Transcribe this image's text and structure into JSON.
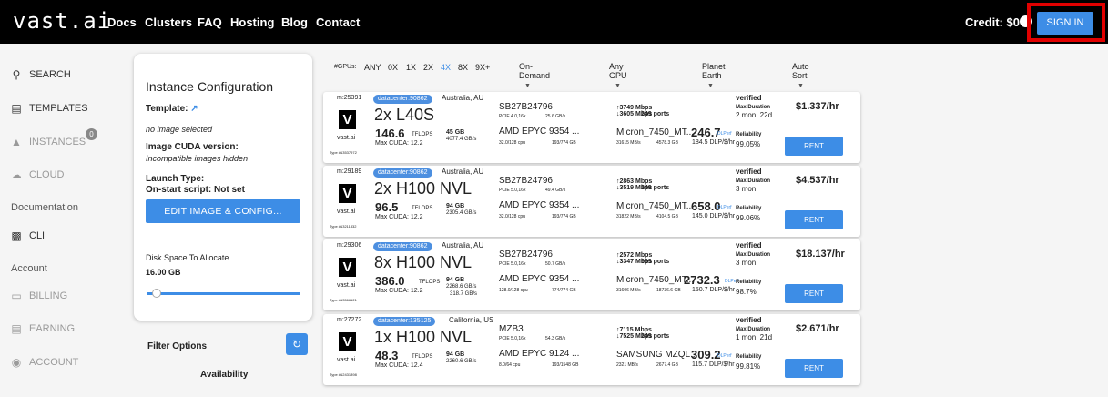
{
  "topbar": {
    "logo": "vast.ai",
    "nav": [
      "Docs",
      "Clusters",
      "FAQ",
      "Hosting",
      "Blog",
      "Contact"
    ],
    "credit": "Credit: $0",
    "sign_in": "SIGN IN"
  },
  "sidebar": {
    "items": [
      {
        "label": "SEARCH",
        "icon": "search-icon"
      },
      {
        "label": "TEMPLATES",
        "icon": "templates-icon"
      },
      {
        "label": "INSTANCES",
        "icon": "instances-icon",
        "badge": "0"
      },
      {
        "label": "CLOUD",
        "icon": "cloud-icon"
      },
      {
        "label": "Documentation"
      },
      {
        "label": "CLI",
        "icon": "terminal-icon"
      },
      {
        "label": "Account"
      },
      {
        "label": "BILLING",
        "icon": "billing-icon"
      },
      {
        "label": "EARNING",
        "icon": "earning-icon"
      },
      {
        "label": "ACCOUNT",
        "icon": "account-icon"
      }
    ]
  },
  "config": {
    "title": "Instance Configuration",
    "template_label": "Template:",
    "no_image": "no image selected",
    "cuda_label": "Image CUDA version:",
    "cuda_note": "Incompatible images hidden",
    "launch_label": "Launch Type:",
    "onstart": "On-start script: Not set",
    "edit_button": "EDIT IMAGE & CONFIG...",
    "disk_label": "Disk Space To Allocate",
    "disk_value": "16.00 GB",
    "disk_fraction": 0.05,
    "filter_label": "Filter Options",
    "availability_label": "Availability"
  },
  "filters": {
    "gpus_label": "#GPUs:",
    "gpu_options": [
      "ANY",
      "0X",
      "1X",
      "2X",
      "4X",
      "8X",
      "9X+"
    ],
    "selected_gpu_option": "4X",
    "dropdowns": [
      "On-Demand",
      "Any GPU",
      "Planet Earth",
      "Auto Sort"
    ]
  },
  "offers": [
    {
      "machine_id": "m:25391",
      "datacenter": "datacenter:90862",
      "location": "Australia, AU",
      "gpu": "2x L40S",
      "tflops": "146.6",
      "tflops_unit": "TFLOPS",
      "max_cuda": "Max CUDA: 12.2",
      "vram": "45 GB",
      "vram_bw": "4077.4 GB/s",
      "host_name": "vast.ai",
      "type_id": "Type #13537972",
      "motherboard": "SB27B24796",
      "pcie": "PCIE 4.0,16x",
      "pcie_bw": "25.6 GB/s",
      "cpu": "AMD EPYC 9354 ...",
      "cpu_cores": "32.0/128 cpu",
      "ram": "193/774 GB",
      "up": "↑3749 Mbps",
      "down": "↓3605 Mbps",
      "ports": "249 ports",
      "disk": "Micron_7450_MT...",
      "disk_bw": "31615 MB/s",
      "disk_size": "4578.3 GB",
      "dlperf": "246.7",
      "dlperf_unit": "DLPerf",
      "dlperf_per_dollar": "184.5 DLP/$/hr",
      "verified": "verified",
      "max_duration_label": "Max Duration",
      "max_duration": "2 mon, 22d",
      "reliability_label": "Reliability",
      "reliability": "99.05%",
      "price": "$1.337/hr",
      "rent": "RENT"
    },
    {
      "machine_id": "m:29189",
      "datacenter": "datacenter:90862",
      "location": "Australia, AU",
      "gpu": "2x H100 NVL",
      "tflops": "96.5",
      "tflops_unit": "TFLOPS",
      "max_cuda": "Max CUDA: 12.2",
      "vram": "94 GB",
      "vram_bw": "2305.4 GB/s",
      "host_name": "vast.ai",
      "type_id": "Type #13211832",
      "motherboard": "SB27B24796",
      "pcie": "PCIE 5.0,16x",
      "pcie_bw": "49.4 GB/s",
      "cpu": "AMD EPYC 9354 ...",
      "cpu_cores": "32.0/128 cpu",
      "ram": "193/774 GB",
      "up": "↑2863 Mbps",
      "down": "↓3519 Mbps",
      "ports": "249 ports",
      "disk": "Micron_7450_MT...",
      "disk_bw": "31822 MB/s",
      "disk_size": "4104.5 GB",
      "dlperf": "658.0",
      "dlperf_unit": "DLPerf",
      "dlperf_per_dollar": "145.0 DLP/$/hr",
      "verified": "verified",
      "max_duration_label": "Max Duration",
      "max_duration": "3 mon.",
      "reliability_label": "Reliability",
      "reliability": "99.06%",
      "price": "$4.537/hr",
      "rent": "RENT"
    },
    {
      "machine_id": "m:29306",
      "datacenter": "datacenter:90862",
      "location": "Australia, AU",
      "gpu": "8x H100 NVL",
      "tflops": "386.0",
      "tflops_unit": "TFLOPS",
      "max_cuda": "Max CUDA: 12.2",
      "vram": "94 GB",
      "vram_bw": "2268.6 GB/s",
      "vram_bw2": "318.7 GB/s",
      "host_name": "vast.ai",
      "type_id": "Type #13566121",
      "motherboard": "SB27B24796",
      "pcie": "PCIE 5.0,16x",
      "pcie_bw": "50.7 GB/s",
      "cpu": "AMD EPYC 9354 ...",
      "cpu_cores": "128.0/128 cpu",
      "ram": "774/774 GB",
      "up": "↑2572 Mbps",
      "down": "↓3347 Mbps",
      "ports": "999 ports",
      "disk": "Micron_7450_MT...",
      "disk_bw": "31606 MB/s",
      "disk_size": "18736.6 GB",
      "dlperf": "2732.3",
      "dlperf_unit": "DLPerf",
      "dlperf_per_dollar": "150.7 DLP/$/hr",
      "verified": "verified",
      "max_duration_label": "Max Duration",
      "max_duration": "3 mon.",
      "reliability_label": "Reliability",
      "reliability": "98.7%",
      "price": "$18.137/hr",
      "rent": "RENT"
    },
    {
      "machine_id": "m:27272",
      "datacenter": "datacenter:135125",
      "location": "California, US",
      "gpu": "1x H100 NVL",
      "tflops": "48.3",
      "tflops_unit": "TFLOPS",
      "max_cuda": "Max CUDA: 12.4",
      "vram": "94 GB",
      "vram_bw": "2260.6 GB/s",
      "host_name": "vast.ai",
      "type_id": "Type #12431898",
      "motherboard": "MZB3",
      "pcie": "PCIE 5.0,16x",
      "pcie_bw": "54.3 GB/s",
      "cpu": "AMD EPYC 9124 ...",
      "cpu_cores": "8.0/64 cpu",
      "ram": "193/1548 GB",
      "up": "↑7115 Mbps",
      "down": "↓7525 Mbps",
      "ports": "249 ports",
      "disk": "SAMSUNG MZQL...",
      "disk_bw": "2321 MB/s",
      "disk_size": "2677.4 GB",
      "dlperf": "309.2",
      "dlperf_unit": "DLPerf",
      "dlperf_per_dollar": "115.7 DLP/$/hr",
      "verified": "verified",
      "max_duration_label": "Max Duration",
      "max_duration": "1 mon, 21d",
      "reliability_label": "Reliability",
      "reliability": "99.81%",
      "price": "$2.671/hr",
      "rent": "RENT"
    }
  ],
  "colors": {
    "accent": "#3d8de6",
    "topbar": "#000000",
    "highlight_box": "#e10000",
    "badge": "#4c8fe0"
  }
}
